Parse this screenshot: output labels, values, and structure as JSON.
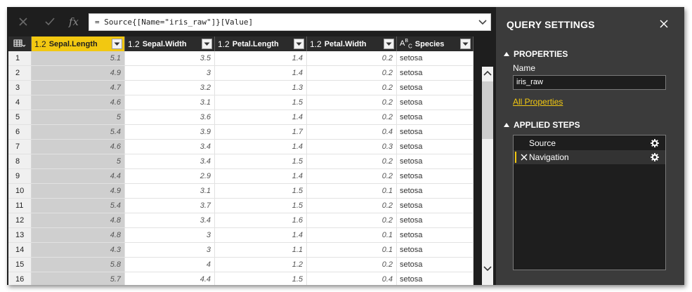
{
  "formula_bar": {
    "formula": "= Source{[Name=\"iris_raw\"]}[Value]",
    "fx_label": "fx"
  },
  "columns": [
    {
      "type": "1.2",
      "name": "Sepal.Length",
      "selected": true
    },
    {
      "type": "1.2",
      "name": "Sepal.Width",
      "selected": false
    },
    {
      "type": "1.2",
      "name": "Petal.Length",
      "selected": false
    },
    {
      "type": "1.2",
      "name": "Petal.Width",
      "selected": false
    },
    {
      "type": "ABC",
      "name": "Species",
      "selected": false
    }
  ],
  "rows": [
    [
      "1",
      "5.1",
      "3.5",
      "1.4",
      "0.2",
      "setosa"
    ],
    [
      "2",
      "4.9",
      "3",
      "1.4",
      "0.2",
      "setosa"
    ],
    [
      "3",
      "4.7",
      "3.2",
      "1.3",
      "0.2",
      "setosa"
    ],
    [
      "4",
      "4.6",
      "3.1",
      "1.5",
      "0.2",
      "setosa"
    ],
    [
      "5",
      "5",
      "3.6",
      "1.4",
      "0.2",
      "setosa"
    ],
    [
      "6",
      "5.4",
      "3.9",
      "1.7",
      "0.4",
      "setosa"
    ],
    [
      "7",
      "4.6",
      "3.4",
      "1.4",
      "0.3",
      "setosa"
    ],
    [
      "8",
      "5",
      "3.4",
      "1.5",
      "0.2",
      "setosa"
    ],
    [
      "9",
      "4.4",
      "2.9",
      "1.4",
      "0.2",
      "setosa"
    ],
    [
      "10",
      "4.9",
      "3.1",
      "1.5",
      "0.1",
      "setosa"
    ],
    [
      "11",
      "5.4",
      "3.7",
      "1.5",
      "0.2",
      "setosa"
    ],
    [
      "12",
      "4.8",
      "3.4",
      "1.6",
      "0.2",
      "setosa"
    ],
    [
      "13",
      "4.8",
      "3",
      "1.4",
      "0.1",
      "setosa"
    ],
    [
      "14",
      "4.3",
      "3",
      "1.1",
      "0.1",
      "setosa"
    ],
    [
      "15",
      "5.8",
      "4",
      "1.2",
      "0.2",
      "setosa"
    ],
    [
      "16",
      "5.7",
      "4.4",
      "1.5",
      "0.4",
      "setosa"
    ]
  ],
  "query_settings": {
    "title": "QUERY SETTINGS",
    "properties_heading": "PROPERTIES",
    "name_label": "Name",
    "name_value": "iris_raw",
    "all_properties_link": "All Properties",
    "applied_steps_heading": "APPLIED STEPS",
    "steps": [
      {
        "label": "Source",
        "active": false
      },
      {
        "label": "Navigation",
        "active": true
      }
    ]
  },
  "colors": {
    "accent": "#f2c811",
    "pane_background": "#3b3b3b",
    "dark_background": "#1e1e1e"
  }
}
